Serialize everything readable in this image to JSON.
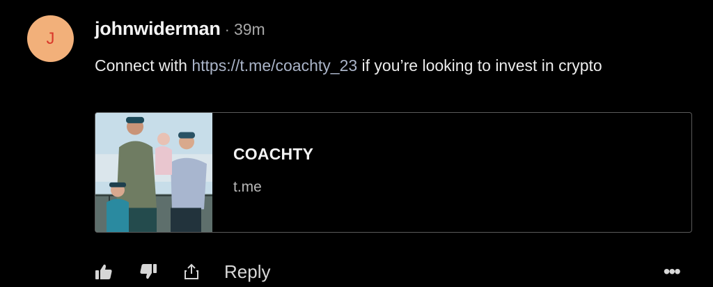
{
  "comment": {
    "avatar_letter": "J",
    "username": "johnwiderman",
    "separator": "·",
    "time": "39m",
    "text_before": "Connect with ",
    "link_text": "https://t.me/coachty_23",
    "text_after": " if you’re looking to invest in crypto"
  },
  "link_card": {
    "title": "COACHTY",
    "domain": "t.me"
  },
  "actions": {
    "like_icon": "thumbs-up-icon",
    "dislike_icon": "thumbs-down-icon",
    "share_icon": "share-icon",
    "reply_label": "Reply",
    "more_icon": "more-options-icon",
    "more_label": "•••"
  },
  "colors": {
    "background": "#000000",
    "avatar_bg": "#f2b07a",
    "avatar_letter": "#d9382a",
    "link": "#aab4c8"
  }
}
